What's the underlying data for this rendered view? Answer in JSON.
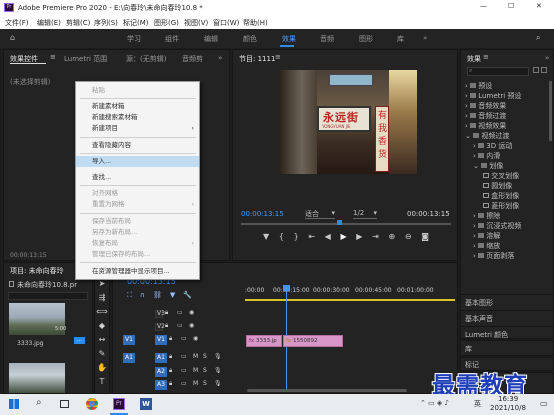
{
  "titlebar": {
    "app_title": "Adobe Premiere Pro 2020 - E:\\向春玲\\未命向春玲10.8 *",
    "min": "—",
    "max": "☐",
    "close": "✕"
  },
  "menubar": {
    "items": [
      "文件(F)",
      "编辑(E)",
      "剪辑(C)",
      "序列(S)",
      "标记(M)",
      "图形(G)",
      "视图(V)",
      "窗口(W)",
      "帮助(H)"
    ]
  },
  "workspaces": {
    "tabs": [
      "学习",
      "组件",
      "编辑",
      "颜色",
      "效果",
      "音频",
      "图形",
      "库"
    ],
    "active": "效果",
    "more": "»"
  },
  "source_panel": {
    "tabs": [
      "效果控件",
      "Lumetri 范围",
      "源：(无剪辑)",
      "音频剪"
    ],
    "menu": "≡",
    "more": "»",
    "no_clip": "(未选择剪辑)",
    "timecode": "00:00:13:15"
  },
  "program": {
    "title": "节目: 1111",
    "menu": "≡",
    "timecode": "00:00:13:15",
    "fit": "适合",
    "scale": "1/2",
    "duration": "00:00:13:15",
    "frame_sign": "永远街",
    "frame_sign_sub": "YONGYUAN JIE",
    "frame_sign_vertical": "有我香货"
  },
  "project_panel": {
    "title": "项目: 未命向春玲",
    "more": "»",
    "path": "未命向春玲10.8.pr",
    "clip1": "3333.jpg",
    "clip1_dur": "5:00"
  },
  "timeline": {
    "timecode": "00:00:13:15",
    "ruler": [
      ":00:00",
      "00:00:15:00",
      "00:00:30:00",
      "00:00:45:00",
      "00:01:00:00"
    ],
    "tracks": [
      {
        "name": "V3",
        "src": ""
      },
      {
        "name": "V2",
        "src": ""
      },
      {
        "name": "V1",
        "src": "V1"
      },
      {
        "name": "A1",
        "src": "A1"
      },
      {
        "name": "A2",
        "src": ""
      },
      {
        "name": "A3",
        "src": ""
      }
    ],
    "clips": [
      {
        "label": "3333.jp"
      },
      {
        "label": "1550892"
      }
    ],
    "fx": "fx"
  },
  "effects_panel": {
    "title": "效果",
    "menu": "≡",
    "more": "»",
    "tree": [
      {
        "label": "预设",
        "level": 0,
        "open": false
      },
      {
        "label": "Lumetri 预设",
        "level": 0,
        "open": false
      },
      {
        "label": "音频效果",
        "level": 0,
        "open": false
      },
      {
        "label": "音频过渡",
        "level": 0,
        "open": false
      },
      {
        "label": "视频效果",
        "level": 0,
        "open": false
      },
      {
        "label": "视频过渡",
        "level": 0,
        "open": true
      },
      {
        "label": "3D 运动",
        "level": 1,
        "open": false
      },
      {
        "label": "内滑",
        "level": 1,
        "open": false
      },
      {
        "label": "划像",
        "level": 1,
        "open": true
      },
      {
        "label": "交叉划像",
        "level": 2,
        "open": false
      },
      {
        "label": "圆划像",
        "level": 2,
        "open": false
      },
      {
        "label": "盒形划像",
        "level": 2,
        "open": false
      },
      {
        "label": "菱形划像",
        "level": 2,
        "open": false
      },
      {
        "label": "擦除",
        "level": 1,
        "open": false
      },
      {
        "label": "沉浸式视频",
        "level": 1,
        "open": false
      },
      {
        "label": "溶解",
        "level": 1,
        "open": false
      },
      {
        "label": "缩放",
        "level": 1,
        "open": false
      },
      {
        "label": "页面剥落",
        "level": 1,
        "open": false
      }
    ],
    "sections": [
      "基本图形",
      "基本声音",
      "Lumetri 颜色",
      "库",
      "标记"
    ]
  },
  "context_menu": {
    "items": [
      {
        "label": "粘贴",
        "disabled": true,
        "sub": false,
        "sep_after": true
      },
      {
        "label": "新建素材箱",
        "disabled": false,
        "sub": false,
        "sep_after": false
      },
      {
        "label": "新建搜索素材箱",
        "disabled": false,
        "sub": false,
        "sep_after": false
      },
      {
        "label": "新建项目",
        "disabled": false,
        "sub": true,
        "sep_after": true
      },
      {
        "label": "查看隐藏内容",
        "disabled": false,
        "sub": false,
        "sep_after": true
      },
      {
        "label": "导入...",
        "disabled": false,
        "sub": false,
        "sep_after": false,
        "hl": true
      },
      {
        "label": "查找...",
        "disabled": false,
        "sub": false,
        "sep_after": true
      },
      {
        "label": "对齐网格",
        "disabled": true,
        "sub": false,
        "sep_after": false
      },
      {
        "label": "重置为网格",
        "disabled": true,
        "sub": true,
        "sep_after": true
      },
      {
        "label": "保存当前布局",
        "disabled": true,
        "sub": false,
        "sep_after": false
      },
      {
        "label": "另存为新布局...",
        "disabled": true,
        "sub": false,
        "sep_after": false
      },
      {
        "label": "恢复布局",
        "disabled": true,
        "sub": true,
        "sep_after": false
      },
      {
        "label": "管理已保存的布局...",
        "disabled": true,
        "sub": false,
        "sep_after": true
      },
      {
        "label": "在资源管理器中显示项目...",
        "disabled": false,
        "sub": false,
        "sep_after": false
      }
    ]
  },
  "taskbar": {
    "time": "16:39",
    "date": "2021/10/8",
    "lang": "英",
    "notif": "▭"
  },
  "watermark": "最需教育",
  "colors": {
    "accent": "#2d8ceb",
    "timecode": "#3d9bff",
    "clip_pink": "#d796c7",
    "menu_hl": "#bfdcf2",
    "playhead": "#4a90ff"
  }
}
